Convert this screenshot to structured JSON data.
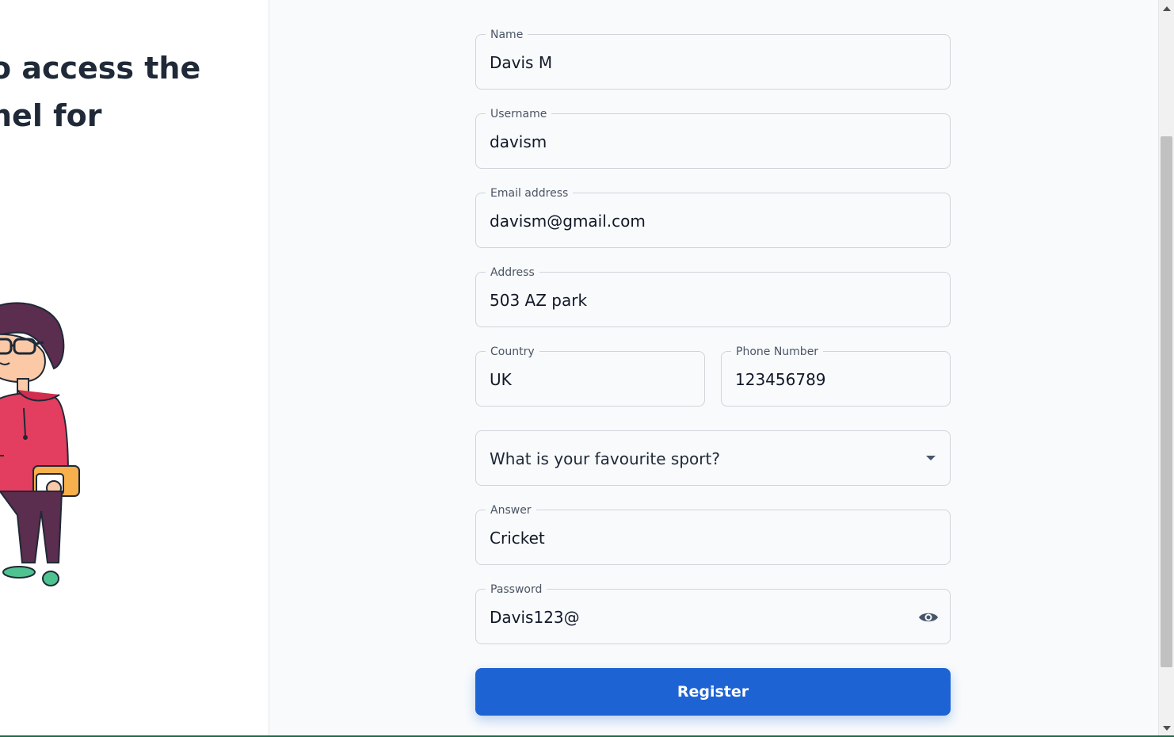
{
  "hero": {
    "line1": "o access the",
    "line2": "nel for"
  },
  "form": {
    "name": {
      "label": "Name",
      "value": "Davis M"
    },
    "username": {
      "label": "Username",
      "value": "davism"
    },
    "email": {
      "label": "Email address",
      "value": "davism@gmail.com"
    },
    "address": {
      "label": "Address",
      "value": "503 AZ park"
    },
    "country": {
      "label": "Country",
      "value": "UK"
    },
    "phone": {
      "label": "Phone Number",
      "value": "123456789"
    },
    "security_question": {
      "selected": "What is your favourite sport?",
      "icon": "chevron-down-icon"
    },
    "answer": {
      "label": "Answer",
      "value": "Cricket"
    },
    "password": {
      "label": "Password",
      "value": "Davis123@",
      "icon": "eye-icon"
    },
    "register_label": "Register"
  },
  "colors": {
    "primary": "#1e63d4",
    "border": "#d1d5db",
    "background": "#f8fafc"
  }
}
